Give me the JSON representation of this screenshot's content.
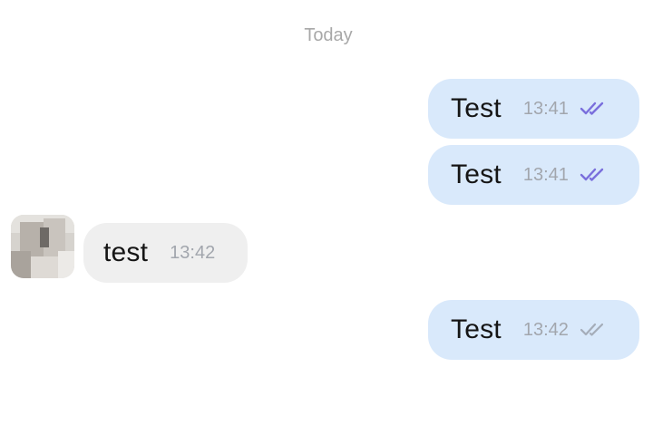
{
  "chat": {
    "date_separator": "Today",
    "messages": [
      {
        "direction": "outgoing",
        "text": "Test",
        "time": "13:41",
        "status": "read",
        "status_icon": "double-check-icon"
      },
      {
        "direction": "outgoing",
        "text": "Test",
        "time": "13:41",
        "status": "read",
        "status_icon": "double-check-icon"
      },
      {
        "direction": "incoming",
        "text": "test",
        "time": "13:42",
        "avatar_icon": "avatar-icon"
      },
      {
        "direction": "outgoing",
        "text": "Test",
        "time": "13:42",
        "status": "delivered",
        "status_icon": "double-check-icon"
      }
    ]
  },
  "colors": {
    "outgoing_bubble": "#d9e9fb",
    "incoming_bubble": "#efefef",
    "read_check": "#7a6fdc",
    "delivered_check": "#a5adb9",
    "timestamp": "#a2a6ad"
  }
}
